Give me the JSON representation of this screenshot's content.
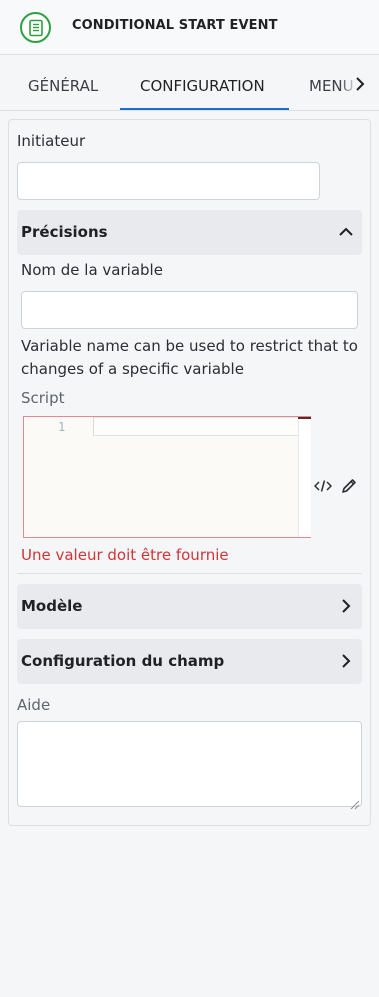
{
  "header": {
    "title": "CONDITIONAL START EVENT",
    "icon": "conditional-event-icon"
  },
  "tabs": [
    {
      "label": "GÉNÉRAL",
      "active": false
    },
    {
      "label": "CONFIGURATION",
      "active": true
    },
    {
      "label": "MENU",
      "active": false
    }
  ],
  "form": {
    "initiator": {
      "label": "Initiateur",
      "value": ""
    },
    "precisions": {
      "title": "Précisions",
      "expanded": true,
      "variable_name": {
        "label": "Nom de la variable",
        "value": "",
        "help": "Variable name can be used to restrict that to changes of a specific variable"
      },
      "script": {
        "label": "Script",
        "line_number": "1",
        "value": "",
        "error": "Une valeur doit être fournie"
      }
    },
    "model_section": {
      "title": "Modèle",
      "expanded": false
    },
    "field_config_section": {
      "title": "Configuration du champ",
      "expanded": false
    },
    "help": {
      "label": "Aide",
      "value": ""
    }
  },
  "colors": {
    "accent": "#1f6fd0",
    "event_green": "#2ea043",
    "error": "#d13438"
  }
}
